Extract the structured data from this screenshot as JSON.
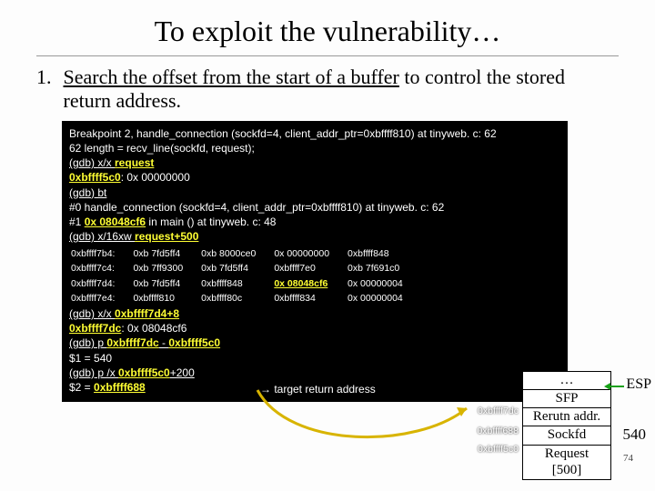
{
  "title": "To exploit the vulnerability…",
  "step_num": "1.",
  "step_text_u": "Search the offset from the start of a buffer",
  "step_text_rest": " to control the stored return address.",
  "term": {
    "l1": "Breakpoint 2, handle_connection (sockfd=4, client_addr_ptr=0xbffff810) at tinyweb. c: 62",
    "l2": "62         length = recv_line(sockfd, request);",
    "l3a": "(gdb) x/x ",
    "l3b": "request",
    "l4a": "0xbffff5c0",
    "l4b": ":      0x 00000000",
    "l5": "(gdb) bt",
    "l6": "#0  handle_connection (sockfd=4, client_addr_ptr=0xbffff810) at tinyweb. c: 62",
    "l7a": "#1  ",
    "l7b": "0x 08048cf6",
    "l7c": " in main () at tinyweb. c: 48",
    "l8a": "(gdb) x/16xw ",
    "l8b": "request+500",
    "hex": [
      [
        "0xbffff7b4:",
        "0xb 7fd5ff4",
        "0xb 8000ce0",
        "0x 00000000",
        "0xbffff848"
      ],
      [
        "0xbffff7c4:",
        "0xb 7ff9300",
        "0xb 7fd5ff4",
        "0xbffff7e0",
        "0xb 7f691c0"
      ],
      [
        "0xbffff7d4:",
        "0xb 7fd5ff4",
        "0xbffff848",
        "0x 08048cf6",
        "0x 00000004"
      ],
      [
        "0xbffff7e4:",
        "0xbffff810",
        "0xbffff80c",
        "0xbffff834",
        "0x 00000004"
      ]
    ],
    "l9a": "(gdb) x/x ",
    "l9b": "0xbffff7d4+8",
    "l10a": "0xbffff7dc",
    "l10b": ":   0x 08048cf6",
    "l11a": "(gdb) p ",
    "l11b": "0xbffff7dc",
    "l11c": " - ",
    "l11d": "0xbffff5c0",
    "l12": "$1 = 540",
    "l13a": "(gdb) p /x ",
    "l13b": "0xbffff5c0",
    "l13c": "+200",
    "l14a": "$2 = ",
    "l14b": "0xbffff688",
    "target": "→  target return address"
  },
  "stack": {
    "c1": "…",
    "c2": "SFP",
    "c3": "Rerutn addr.",
    "c4": "Sockfd",
    "c5": "Request",
    "c6": "[500]"
  },
  "labels": {
    "esp": "ESP",
    "v540": "540",
    "pg": "74",
    "a1": "0xbffff7dc",
    "a2": "0xbffff688",
    "a3": "0xbffff5c0"
  }
}
